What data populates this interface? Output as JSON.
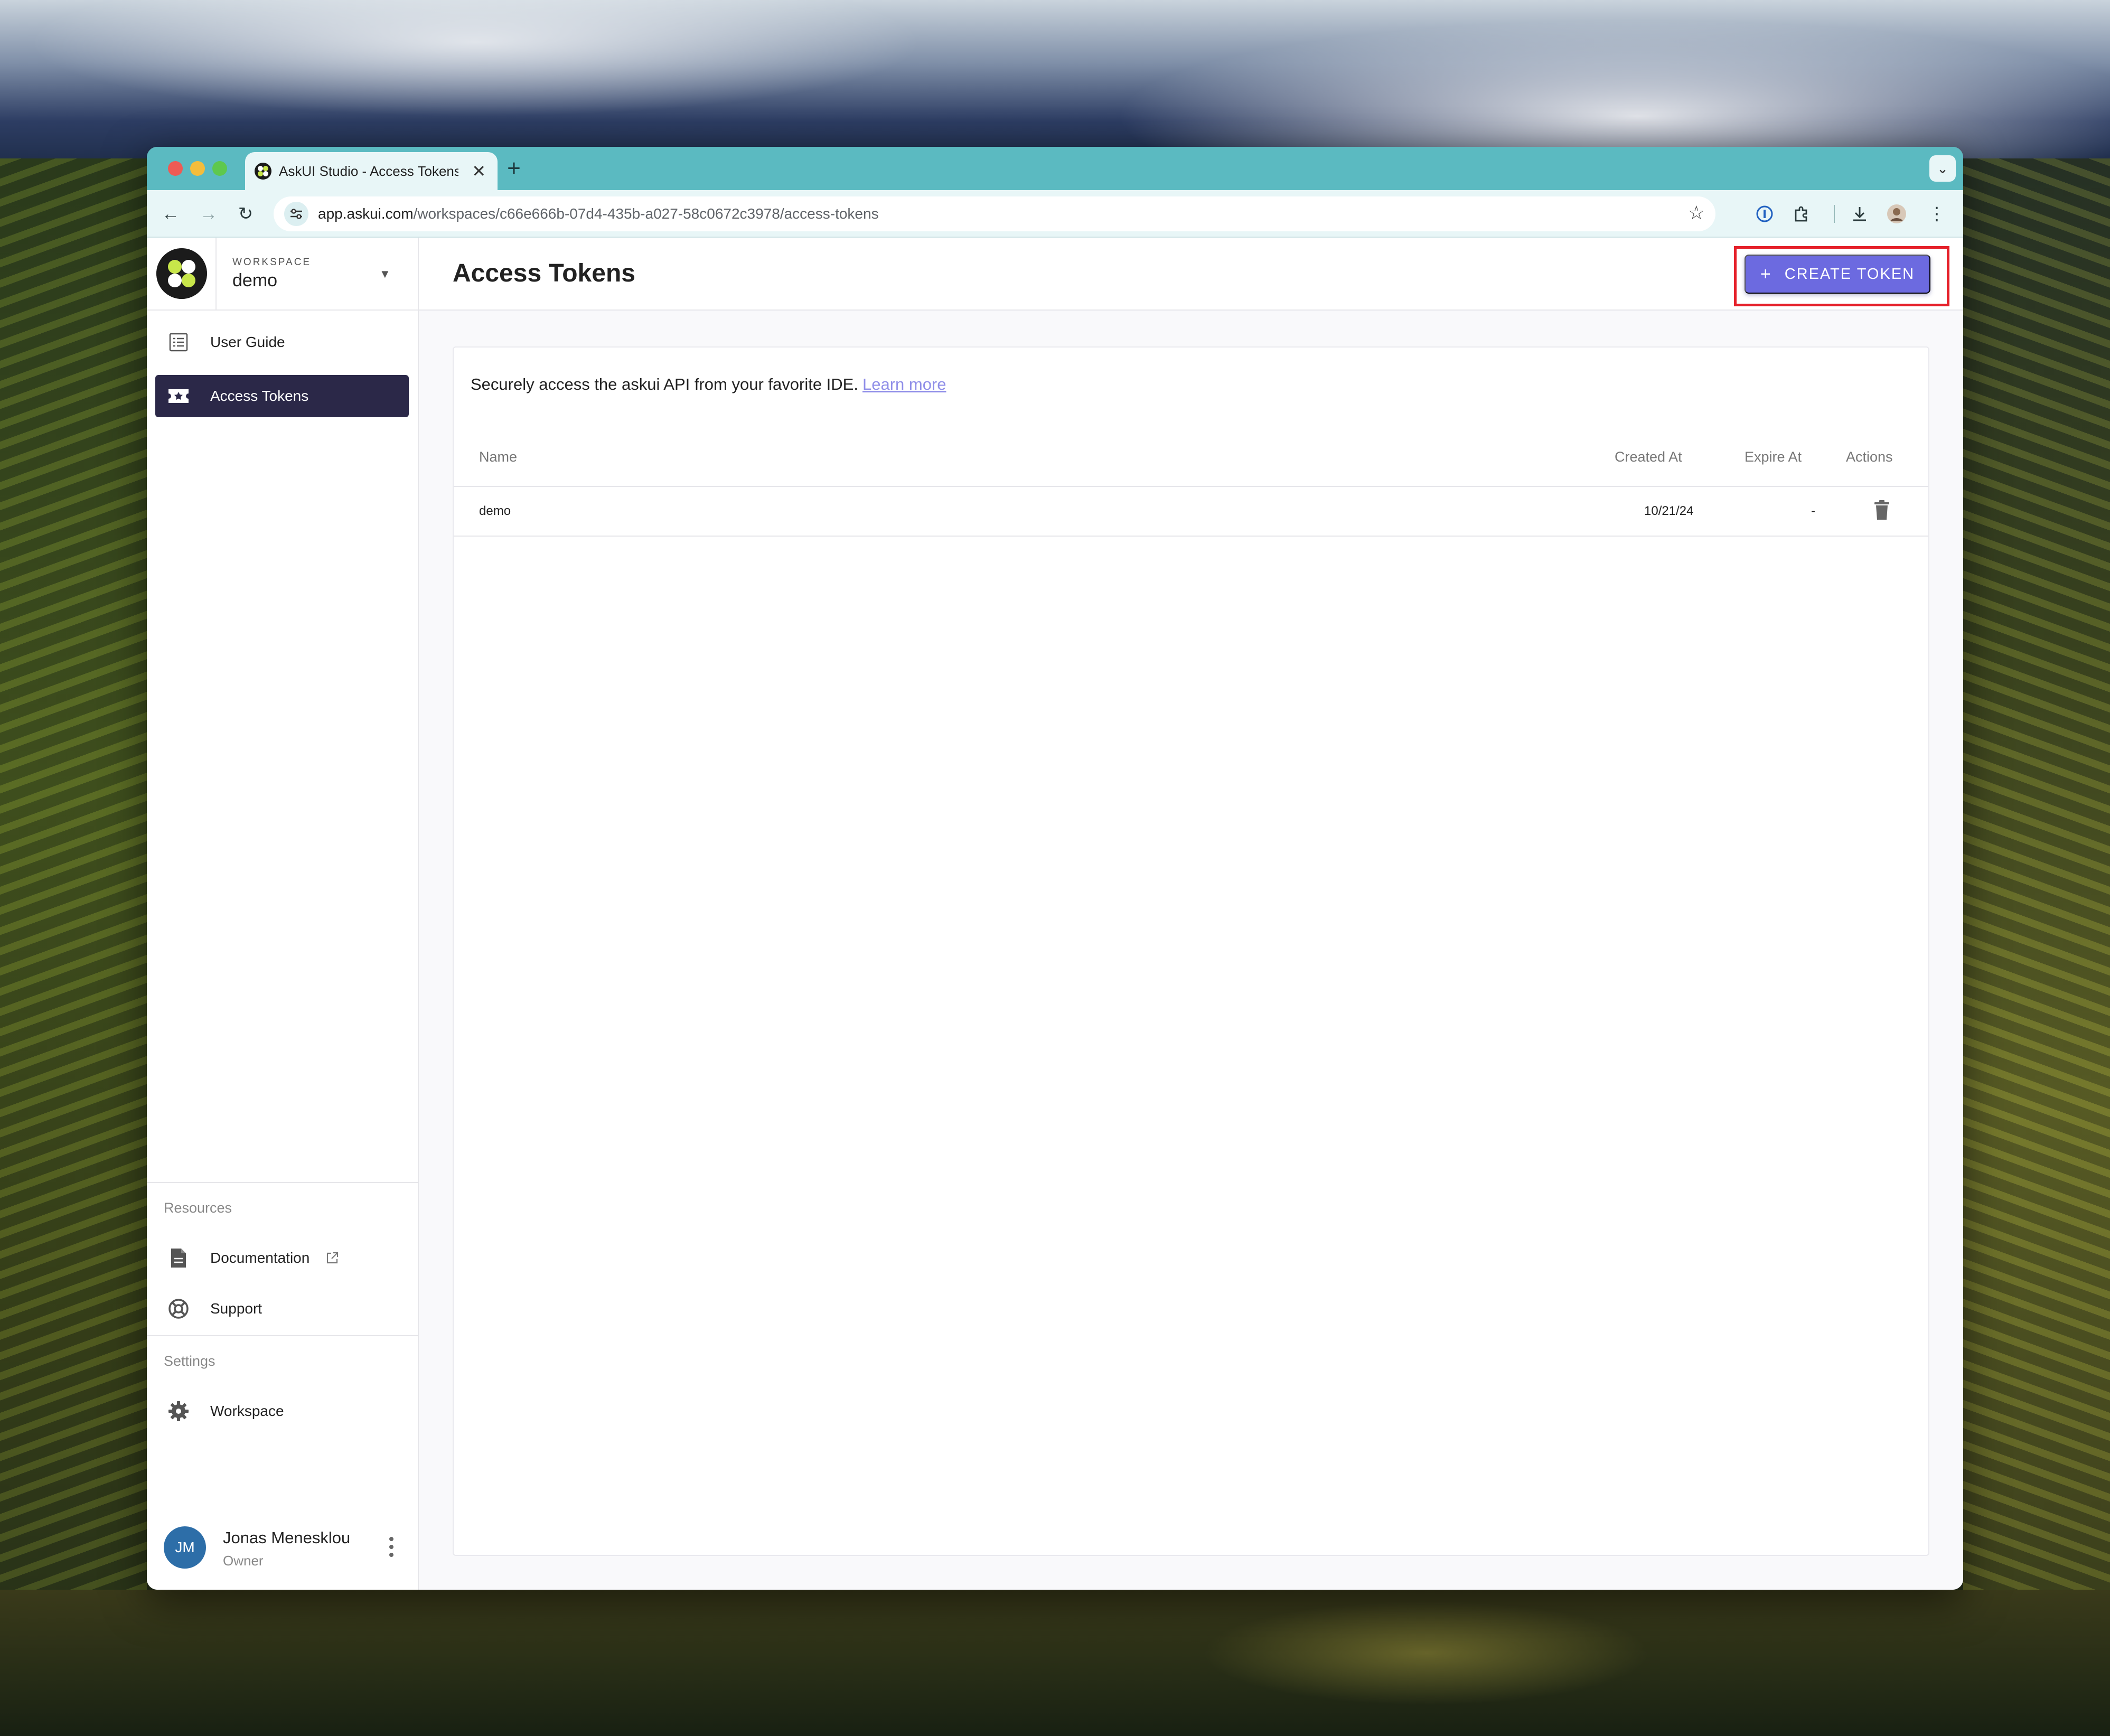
{
  "browser": {
    "tab_title": "AskUI Studio - Access Tokens",
    "url_host": "app.askui.com",
    "url_path": "/workspaces/c66e666b-07d4-435b-a027-58c0672c3978/access-tokens"
  },
  "workspace": {
    "label": "WORKSPACE",
    "name": "demo"
  },
  "sidebar": {
    "items": [
      {
        "label": "User Guide",
        "icon": "list-icon"
      },
      {
        "label": "Access Tokens",
        "icon": "ticket-icon",
        "active": true
      }
    ],
    "resources_heading": "Resources",
    "resources": [
      {
        "label": "Documentation",
        "icon": "document-icon"
      },
      {
        "label": "Support",
        "icon": "lifebuoy-icon"
      }
    ],
    "settings_heading": "Settings",
    "settings": [
      {
        "label": "Workspace",
        "icon": "gear-icon"
      }
    ]
  },
  "user": {
    "initials": "JM",
    "name": "Jonas Menesklou",
    "role": "Owner"
  },
  "page": {
    "title": "Access Tokens",
    "create_button": "CREATE TOKEN",
    "intro": "Securely access the askui API from your favorite IDE.",
    "learn_more": "Learn more"
  },
  "table": {
    "headers": [
      "Name",
      "Created At",
      "Expire At",
      "Actions"
    ],
    "rows": [
      {
        "name": "demo",
        "created_at": "10/21/24",
        "expire_at": "-"
      }
    ]
  },
  "colors": {
    "accent": "#6c6ae0",
    "nav_active": "#2b2848",
    "browser_frame": "#5bbac1",
    "highlight": "#e5202a"
  }
}
